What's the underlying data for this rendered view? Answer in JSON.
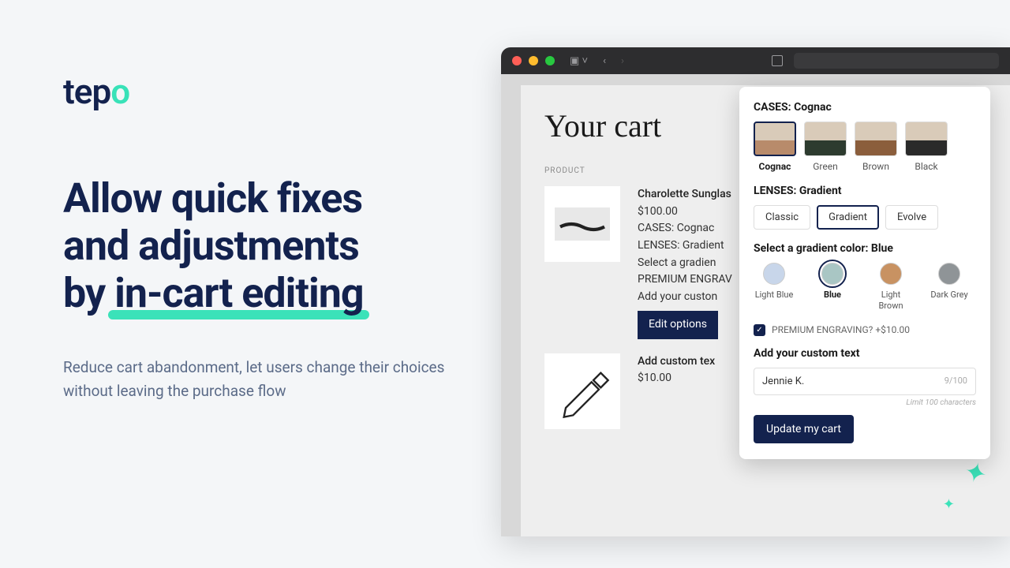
{
  "brand": {
    "name": "tepo"
  },
  "hero": {
    "line1": "Allow quick fixes",
    "line2": "and adjustments",
    "line3_pre": "by ",
    "line3_hl": "in-cart editing",
    "sub": "Reduce cart abandonment, let users change their choices without leaving the purchase flow"
  },
  "cart": {
    "title": "Your cart",
    "col_product": "PRODUCT",
    "items": [
      {
        "name": "Charolette Sunglas",
        "price": "$100.00",
        "meta1": "CASES: Cognac",
        "meta2": "LENSES: Gradient",
        "meta3": "Select a gradien",
        "meta4": "PREMIUM ENGRAV",
        "meta5": "Add your custon",
        "edit": "Edit options"
      },
      {
        "name": "Add custom tex",
        "price": "$10.00"
      }
    ]
  },
  "panel": {
    "cases_label": "CASES: Cognac",
    "cases": [
      "Cognac",
      "Green",
      "Brown",
      "Black"
    ],
    "cases_selected": 0,
    "case_colors": [
      "#b88b6b",
      "#2d3b2f",
      "#8b5e3c",
      "#2a2a2a"
    ],
    "lenses_label": "LENSES: Gradient",
    "lenses": [
      "Classic",
      "Gradient",
      "Evolve"
    ],
    "lenses_selected": 1,
    "grad_label": "Select a gradient color: Blue",
    "grad": [
      {
        "name": "Light Blue",
        "color": "#c8d6ea"
      },
      {
        "name": "Blue",
        "color": "#a9c6c4"
      },
      {
        "name": "Light Brown",
        "color": "#c89262"
      },
      {
        "name": "Dark Grey",
        "color": "#8f9497"
      }
    ],
    "grad_selected": 1,
    "engrave": "PREMIUM ENGRAVING? +$10.00",
    "custom_label": "Add your custom text",
    "custom_value": "Jennie K.",
    "custom_count": "9/100",
    "limit": "Limit 100 characters",
    "update": "Update my cart"
  }
}
